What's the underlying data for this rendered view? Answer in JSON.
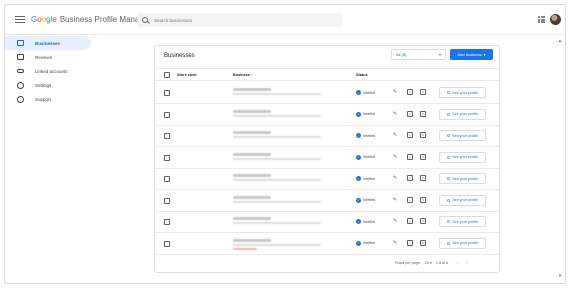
{
  "header": {
    "logo_google": [
      "G",
      "o",
      "o",
      "g",
      "l",
      "e"
    ],
    "logo_rest": "Business Profile Manager",
    "search_placeholder": "Search businesses"
  },
  "sidebar": {
    "items": [
      {
        "label": "Businesses",
        "icon": "store-icon",
        "active": true
      },
      {
        "label": "Reviews",
        "icon": "reviews-icon",
        "active": false
      },
      {
        "label": "Linked accounts",
        "icon": "link-icon",
        "active": false
      },
      {
        "label": "Settings",
        "icon": "gear-icon",
        "active": false
      },
      {
        "label": "Support",
        "icon": "help-icon",
        "active": false
      }
    ]
  },
  "card": {
    "title": "Businesses",
    "filter_value": "All (8)",
    "add_button": "Add business",
    "columns": {
      "store_code": "Store code",
      "business": "Business",
      "status": "Status"
    },
    "rows": [
      {
        "status": "Verified",
        "action": "See your profile",
        "red_line": false
      },
      {
        "status": "Verified",
        "action": "See your profile",
        "red_line": false
      },
      {
        "status": "Verified",
        "action": "See your profile",
        "red_line": false
      },
      {
        "status": "Verified",
        "action": "See your profile",
        "red_line": false
      },
      {
        "status": "Verified",
        "action": "See your profile",
        "red_line": false
      },
      {
        "status": "Verified",
        "action": "See your profile",
        "red_line": false
      },
      {
        "status": "Verified",
        "action": "See your profile",
        "red_line": false
      },
      {
        "status": "Verified",
        "action": "See your profile",
        "red_line": true
      }
    ],
    "footer": {
      "rows_per_page_label": "Rows per page:",
      "rows_per_page_value": "20",
      "range": "1-8 of 8"
    }
  },
  "colors": {
    "accent": "#1a73e8",
    "nav_active_bg": "#e8f0fe"
  }
}
